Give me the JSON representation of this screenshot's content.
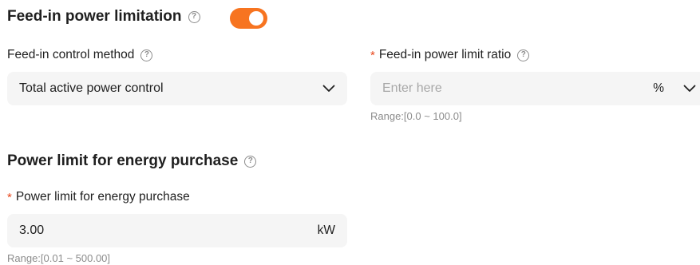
{
  "feed_in": {
    "title": "Feed-in power limitation",
    "help_glyph": "?",
    "toggle_on": true,
    "toggle_color": "#f77420"
  },
  "control_method": {
    "label": "Feed-in control method",
    "help_glyph": "?",
    "selected": "Total active power control"
  },
  "limit_ratio": {
    "required_mark": "*",
    "label": "Feed-in power limit ratio",
    "help_glyph": "?",
    "placeholder": "Enter here",
    "unit": "%",
    "range": "Range:[0.0 ~ 100.0]"
  },
  "purchase": {
    "title": "Power limit for energy purchase",
    "help_glyph": "?",
    "field_required_mark": "*",
    "field_label": "Power limit for energy purchase",
    "value": "3.00",
    "unit": "kW",
    "range": "Range:[0.01 ~ 500.00]"
  },
  "colors": {
    "accent": "#f77420",
    "required": "#e8471c",
    "input_bg": "#f5f5f5"
  }
}
